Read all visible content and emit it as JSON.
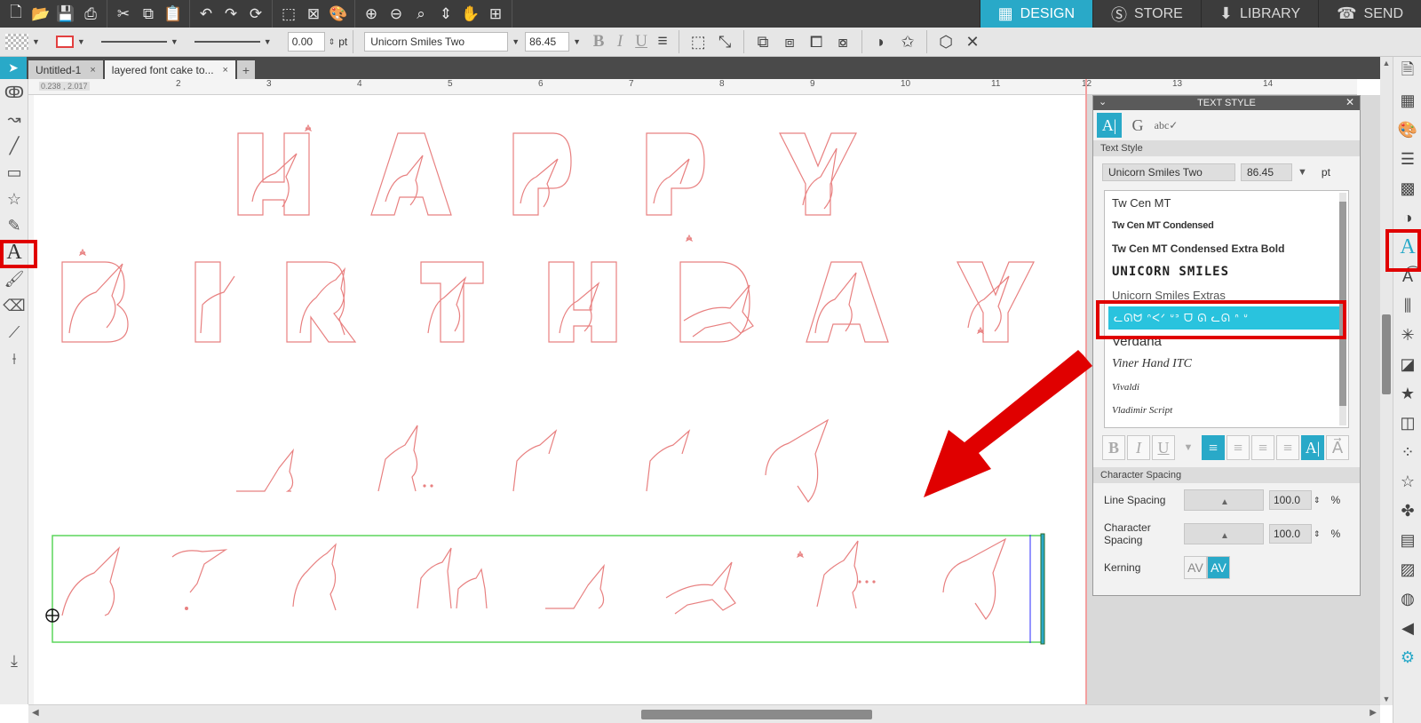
{
  "nav_tabs": [
    {
      "label": "DESIGN",
      "icon": "grid-icon",
      "active": true
    },
    {
      "label": "STORE",
      "icon": "store-icon",
      "active": false
    },
    {
      "label": "LIBRARY",
      "icon": "library-icon",
      "active": false
    },
    {
      "label": "SEND",
      "icon": "send-icon",
      "active": false
    }
  ],
  "toolbar": {
    "line_width_value": "0.00",
    "line_width_unit": "pt",
    "font_name": "Unicorn Smiles Two",
    "font_size": "86.45",
    "bold": "B",
    "italic": "I",
    "underline": "U"
  },
  "doc_tabs": [
    {
      "label": "Untitled-1",
      "close": "×"
    },
    {
      "label": "layered font cake to...",
      "close": "×"
    }
  ],
  "add_tab": "+",
  "ruler": {
    "coord": "0.238 , 2.017",
    "ticks": [
      "2",
      "3",
      "4",
      "5",
      "6",
      "7",
      "8",
      "9",
      "10",
      "11",
      "12",
      "13",
      "14"
    ]
  },
  "text_style_panel": {
    "title": "TEXT STYLE",
    "section_text_style": "Text Style",
    "font_name": "Unicorn Smiles Two",
    "font_size": "86.45",
    "size_unit": "pt",
    "font_list": [
      "Tw Cen MT",
      "Tw Cen MT Condensed",
      "Tw Cen MT Condensed Extra Bold",
      "UNICORN SMILES",
      "Unicorn Smiles Extras",
      "Unicorn Smiles Two",
      "Verdana",
      "Viner Hand ITC",
      "Vivaldi",
      "Vladimir Script"
    ],
    "selected_font_index": 5,
    "selected_font_display": "ᓚᘏᗢ ᐢᐸᐟ ᐡᐣ ᗜ ᘏ ᓚᘏ ᐢ ᐡ",
    "section_char_spacing": "Character Spacing",
    "line_spacing_label": "Line Spacing",
    "line_spacing_value": "100.0",
    "char_spacing_label": "Character Spacing",
    "char_spacing_value": "100.0",
    "percent": "%",
    "kerning_label": "Kerning",
    "kerning_a": "AV",
    "kerning_b": "AV"
  },
  "colors": {
    "accent": "#29a9c8",
    "design_stroke": "#e88080",
    "annotation": "#e00000",
    "selection": "#5cd65c"
  }
}
